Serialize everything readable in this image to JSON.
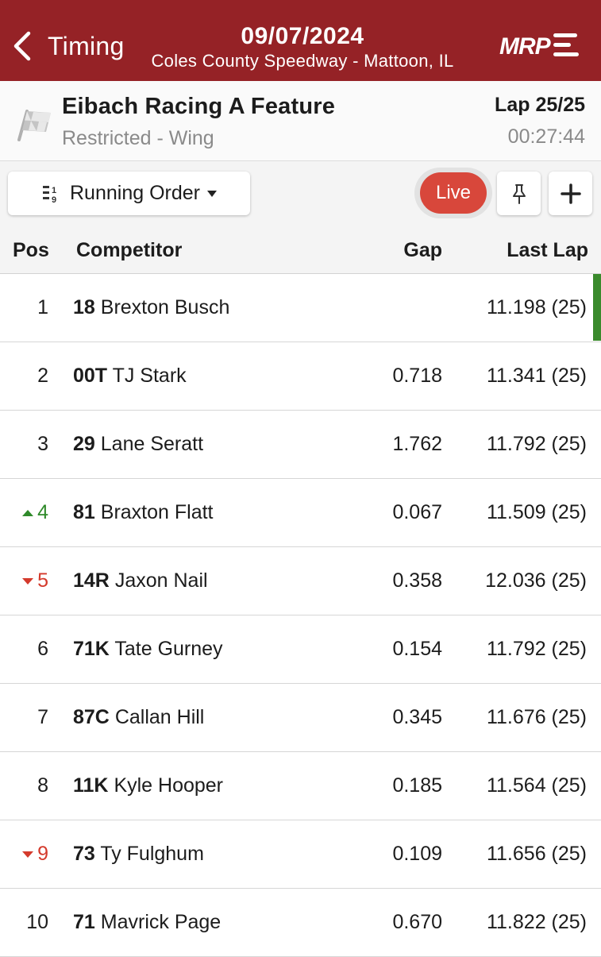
{
  "header": {
    "back_label": "Timing",
    "date": "09/07/2024",
    "track": "Coles County Speedway - Mattoon, IL",
    "logo_text": "MRP",
    "bg_color": "#952226"
  },
  "race": {
    "title": "Eibach Racing A Feature",
    "subtitle": "Restricted - Wing",
    "lap": "Lap 25/25",
    "elapsed": "00:27:44"
  },
  "toolbar": {
    "order_label": "Running Order",
    "live_label": "Live",
    "live_color": "#d8473b"
  },
  "table": {
    "headers": {
      "pos": "Pos",
      "competitor": "Competitor",
      "gap": "Gap",
      "last_lap": "Last Lap"
    },
    "rows": [
      {
        "pos": "1",
        "change": "none",
        "num": "18",
        "name": "Brexton Busch",
        "gap": "",
        "last": "11.198 (25)",
        "leader": true
      },
      {
        "pos": "2",
        "change": "none",
        "num": "00T",
        "name": "TJ Stark",
        "gap": "0.718",
        "last": "11.341 (25)"
      },
      {
        "pos": "3",
        "change": "none",
        "num": "29",
        "name": "Lane Seratt",
        "gap": "1.762",
        "last": "11.792 (25)"
      },
      {
        "pos": "4",
        "change": "up",
        "num": "81",
        "name": "Braxton Flatt",
        "gap": "0.067",
        "last": "11.509 (25)"
      },
      {
        "pos": "5",
        "change": "down",
        "num": "14R",
        "name": "Jaxon Nail",
        "gap": "0.358",
        "last": "12.036 (25)"
      },
      {
        "pos": "6",
        "change": "none",
        "num": "71K",
        "name": "Tate Gurney",
        "gap": "0.154",
        "last": "11.792 (25)"
      },
      {
        "pos": "7",
        "change": "none",
        "num": "87C",
        "name": "Callan Hill",
        "gap": "0.345",
        "last": "11.676 (25)"
      },
      {
        "pos": "8",
        "change": "none",
        "num": "11K",
        "name": "Kyle Hooper",
        "gap": "0.185",
        "last": "11.564 (25)"
      },
      {
        "pos": "9",
        "change": "down",
        "num": "73",
        "name": "Ty Fulghum",
        "gap": "0.109",
        "last": "11.656 (25)"
      },
      {
        "pos": "10",
        "change": "none",
        "num": "71",
        "name": "Mavrick Page",
        "gap": "0.670",
        "last": "11.822 (25)"
      }
    ]
  }
}
